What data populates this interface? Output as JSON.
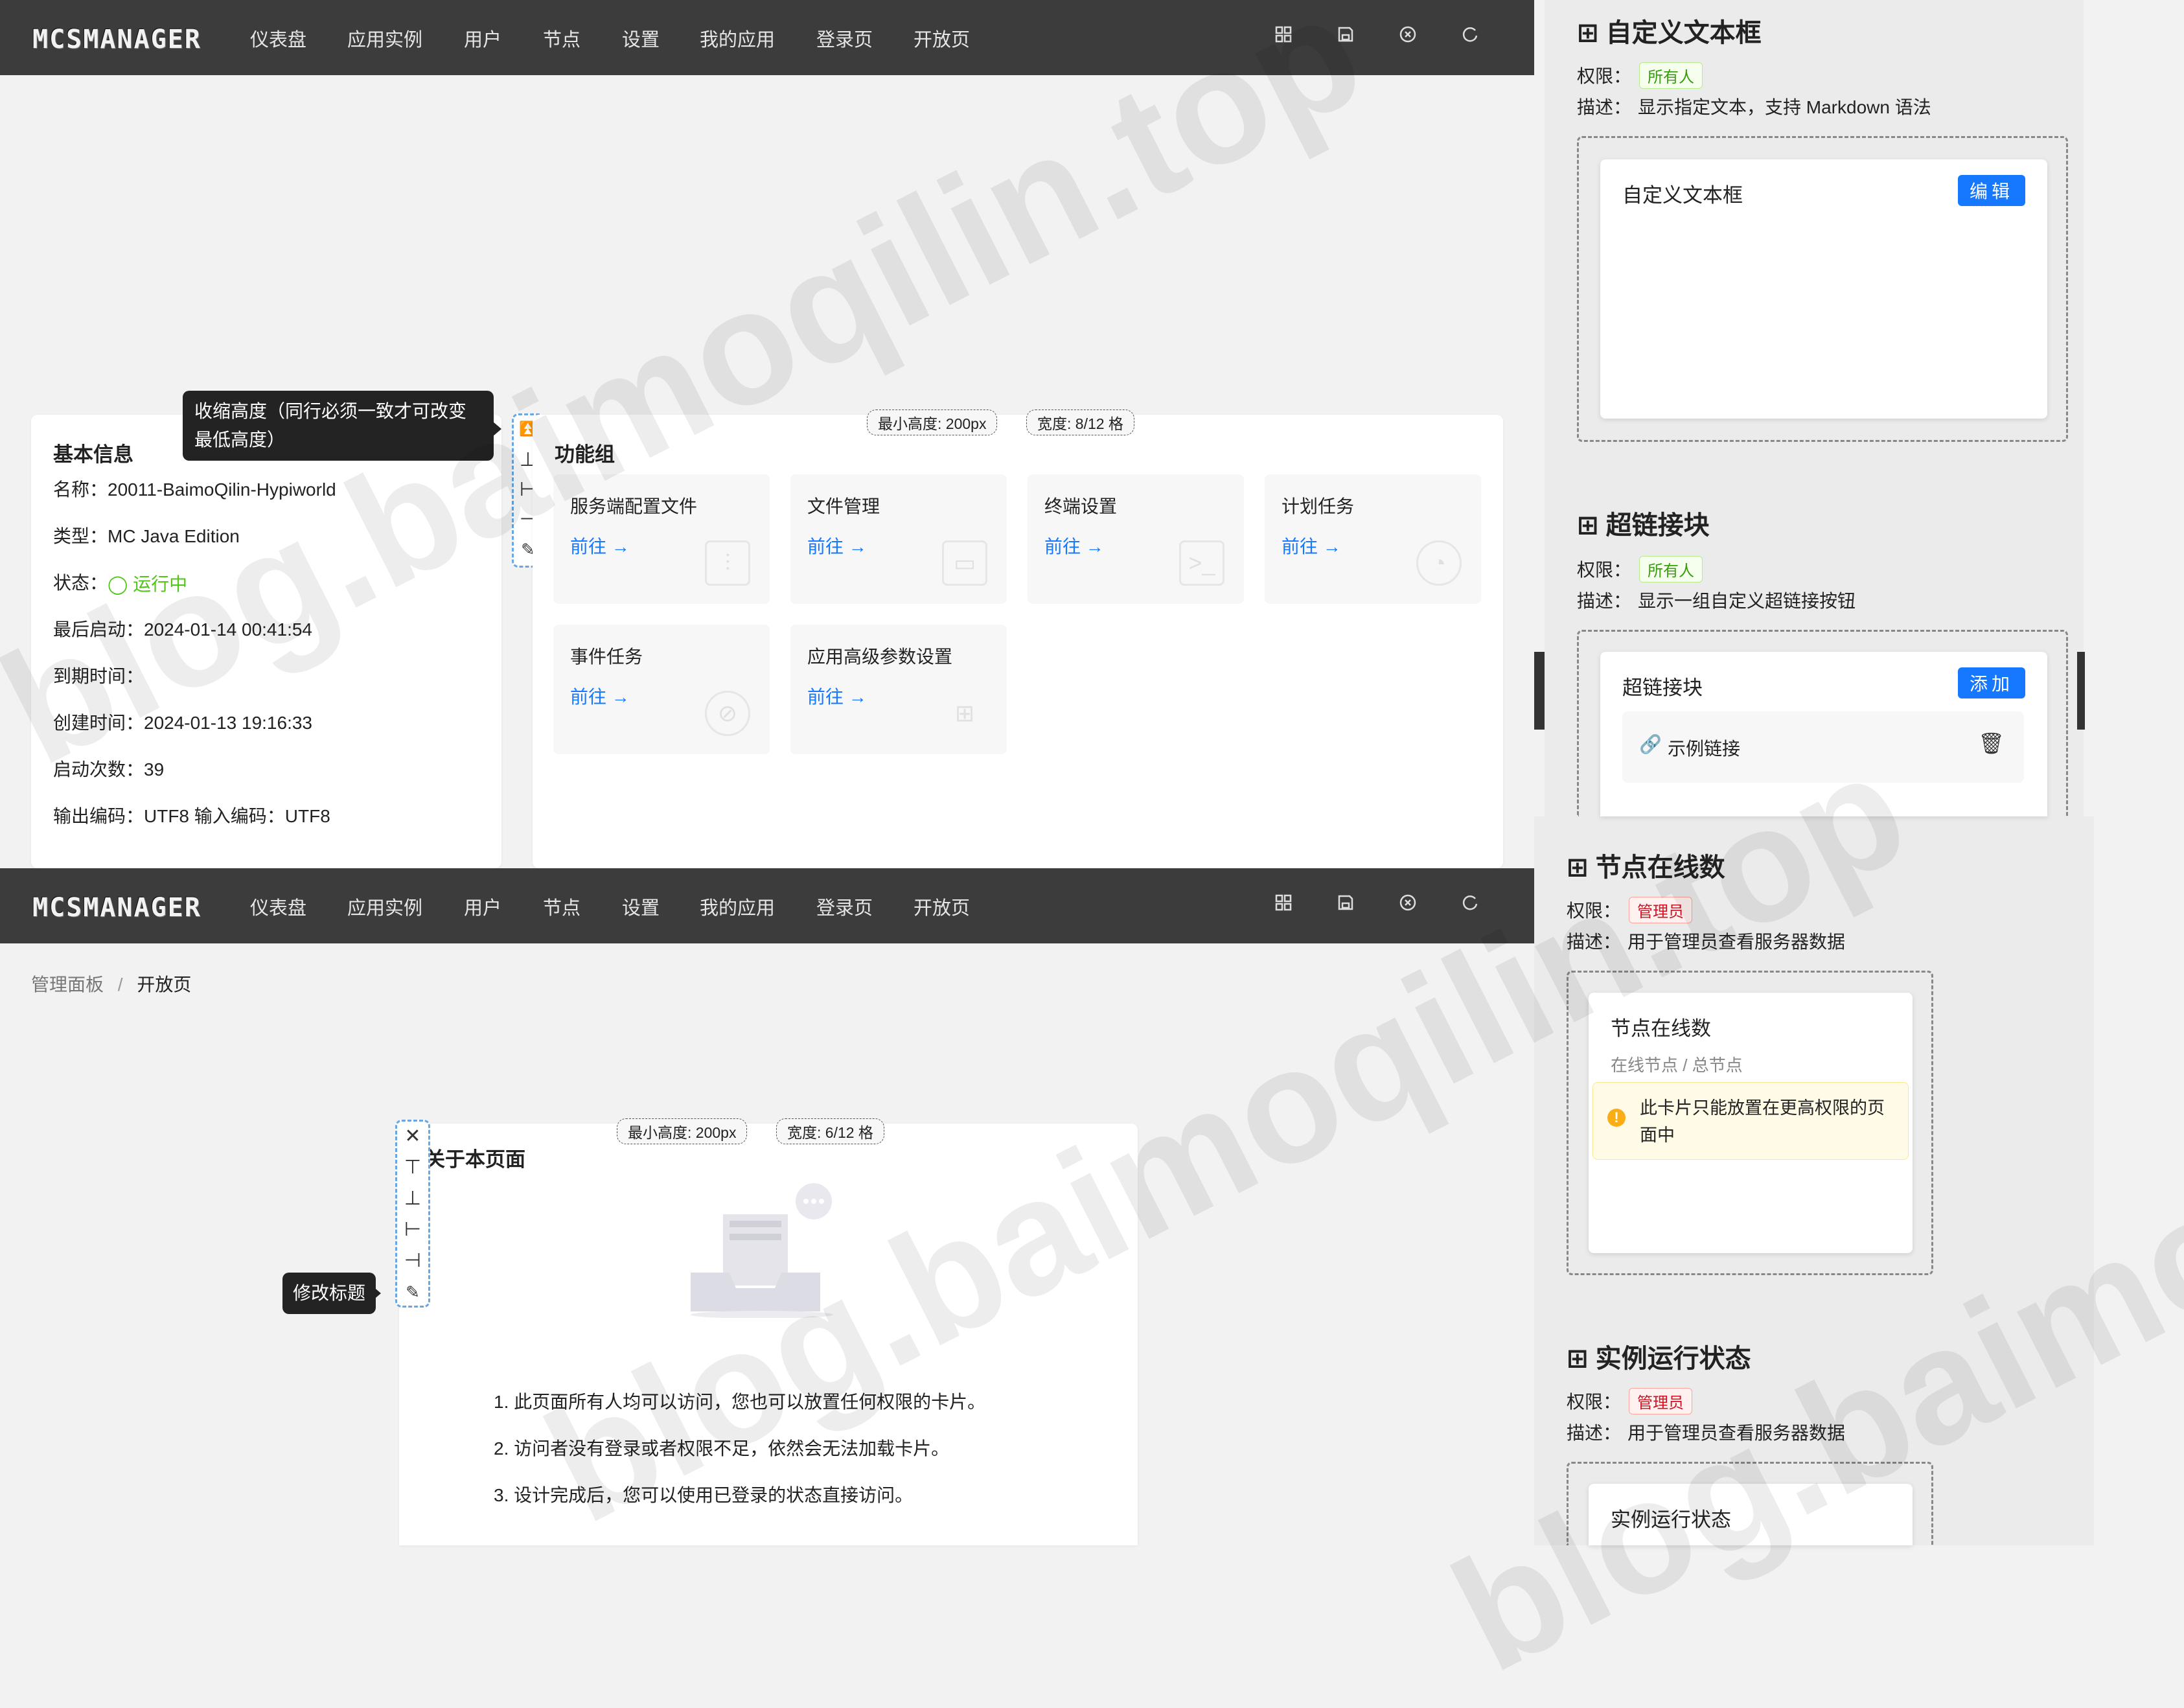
{
  "nav": {
    "logo": "MCSMANAGER",
    "items": [
      "仪表盘",
      "应用实例",
      "用户",
      "节点",
      "设置",
      "我的应用",
      "登录页",
      "开放页"
    ],
    "icons": [
      "layout-icon",
      "save-icon",
      "close-circle-icon",
      "refresh-icon"
    ]
  },
  "top": {
    "tooltip": "收缩高度（同行必须一致才可改变最低高度）",
    "basic_info": {
      "title": "基本信息",
      "rows": [
        "名称：20011-BaimoQilin-Hypiworld",
        "类型：MC Java Edition",
        "状态：",
        "最后启动：2024-01-14 00:41:54",
        "到期时间：",
        "创建时间：2024-01-13 19:16:33",
        "启动次数：39",
        "输出编码：UTF8  输入编码：UTF8"
      ],
      "status_value": "运行中"
    },
    "func_group": {
      "title": "功能组",
      "min_height_tag": "最小高度: 200px",
      "width_tag": "宽度: 8/12 格",
      "link_label": "前往 →",
      "tiles": [
        "服务端配置文件",
        "文件管理",
        "终端设置",
        "计划任务",
        "事件任务",
        "应用高级参数设置"
      ]
    }
  },
  "bottom": {
    "breadcrumb": [
      "管理面板",
      "/",
      "开放页"
    ],
    "tooltip": "修改标题",
    "about_card": {
      "title": "关于本页面",
      "min_height_tag": "最小高度: 200px",
      "width_tag": "宽度: 6/12 格",
      "lines": [
        "1. 此页面所有人均可以访问，您也可以放置任何权限的卡片。",
        "2. 访问者没有登录或者权限不足，依然会无法加载卡片。",
        "3. 设计完成后，您可以使用已登录的状态直接访问。"
      ]
    }
  },
  "sidebar": {
    "perm_label": "权限：",
    "desc_label": "描述：",
    "sections": [
      {
        "title": "自定义文本框",
        "perm": "所有人",
        "desc": "显示指定文本，支持 Markdown 语法",
        "card_title": "自定义文本框",
        "button": "编辑"
      },
      {
        "title": "超链接块",
        "perm": "所有人",
        "desc": "显示一组自定义超链接按钮",
        "card_title": "超链接块",
        "button": "添加",
        "link_item": "示例链接"
      },
      {
        "title": "节点在线数",
        "perm": "管理员",
        "desc": "用于管理员查看服务器数据",
        "card_title": "节点在线数",
        "subtitle": "在线节点 / 总节点",
        "warning": "此卡片只能放置在更高权限的页面中"
      },
      {
        "title": "实例运行状态",
        "perm": "管理员",
        "desc": "用于管理员查看服务器数据",
        "card_title": "实例运行状态"
      }
    ]
  },
  "watermark": "blog.baimoqilin.top",
  "colors": {
    "accent": "#1677ff",
    "nav_bg": "#3c3c3c",
    "success": "#52c41a",
    "warning": "#faad14"
  }
}
